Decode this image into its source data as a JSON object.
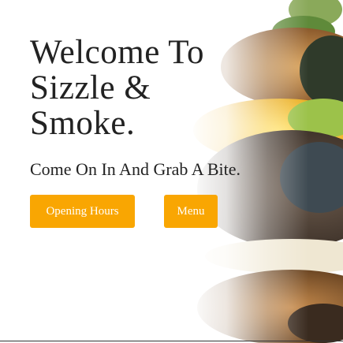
{
  "hero": {
    "title_line1": "Welcome To",
    "title_line2": "Sizzle &",
    "title_line3": "Smoke.",
    "subtitle": "Come On In And Grab A Bite."
  },
  "buttons": {
    "opening_hours_label": "Opening Hours",
    "menu_label": "Menu"
  },
  "colors": {
    "accent": "#f9a602",
    "text": "#222222",
    "background": "#ffffff"
  },
  "image": {
    "subject": "burger-photo"
  }
}
